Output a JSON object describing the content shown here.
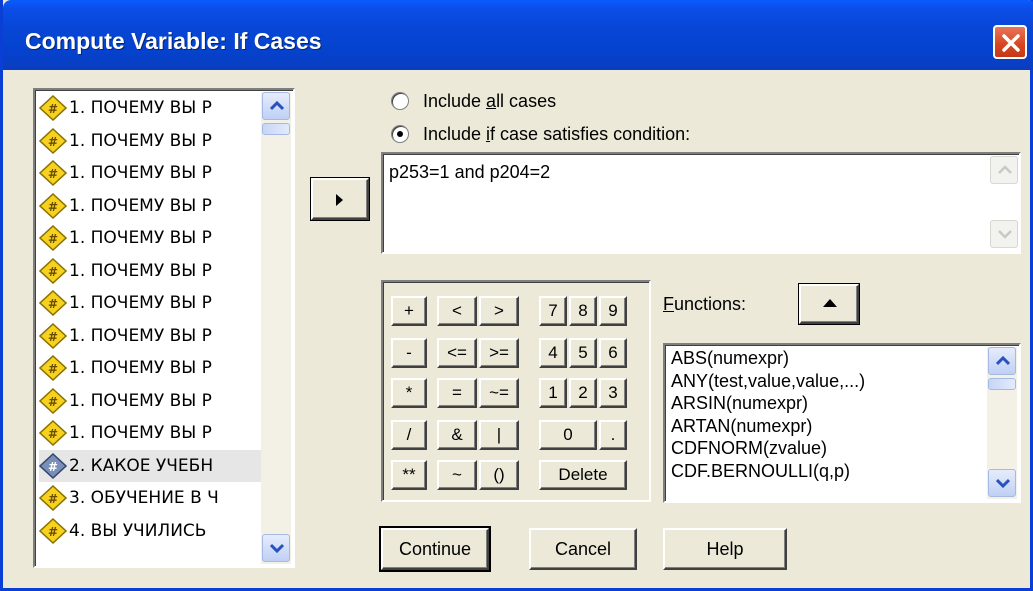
{
  "window": {
    "title": "Compute Variable: If Cases"
  },
  "variables": [
    {
      "label": "1. ПОЧЕМУ ВЫ Р",
      "type": "numeric-nominal",
      "selected": false
    },
    {
      "label": "1. ПОЧЕМУ ВЫ Р",
      "type": "numeric-nominal",
      "selected": false
    },
    {
      "label": "1. ПОЧЕМУ ВЫ Р",
      "type": "numeric-nominal",
      "selected": false
    },
    {
      "label": "1. ПОЧЕМУ ВЫ Р",
      "type": "numeric-nominal",
      "selected": false
    },
    {
      "label": "1. ПОЧЕМУ ВЫ Р",
      "type": "numeric-nominal",
      "selected": false
    },
    {
      "label": "1. ПОЧЕМУ ВЫ Р",
      "type": "numeric-nominal",
      "selected": false
    },
    {
      "label": "1. ПОЧЕМУ ВЫ Р",
      "type": "numeric-nominal",
      "selected": false
    },
    {
      "label": "1. ПОЧЕМУ ВЫ Р",
      "type": "numeric-nominal",
      "selected": false
    },
    {
      "label": "1. ПОЧЕМУ ВЫ Р",
      "type": "numeric-nominal",
      "selected": false
    },
    {
      "label": "1. ПОЧЕМУ ВЫ Р",
      "type": "numeric-nominal",
      "selected": false
    },
    {
      "label": "1. ПОЧЕМУ ВЫ Р",
      "type": "numeric-nominal",
      "selected": false
    },
    {
      "label": "2. КАКОЕ УЧЕБН",
      "type": "numeric-scale",
      "selected": true
    },
    {
      "label": "3. ОБУЧЕНИЕ В Ч",
      "type": "numeric-nominal",
      "selected": false
    },
    {
      "label": "4. ВЫ УЧИЛИСЬ",
      "type": "numeric-nominal",
      "selected": false
    }
  ],
  "options": {
    "include_all_pre": "Include ",
    "include_all_key": "a",
    "include_all_post": "ll cases",
    "include_if_pre": "Include ",
    "include_if_key": "i",
    "include_if_post": "f case satisfies condition:",
    "selected": "include_if"
  },
  "condition": {
    "expression": "p253=1 and p204=2"
  },
  "keypad": {
    "row1": [
      "+",
      "<",
      ">",
      "7",
      "8",
      "9"
    ],
    "row2": [
      "-",
      "<=",
      ">=",
      "4",
      "5",
      "6"
    ],
    "row3": [
      "*",
      "=",
      "~=",
      "1",
      "2",
      "3"
    ],
    "row4": [
      "/",
      "&",
      "|",
      "0",
      "."
    ],
    "row5": [
      "**",
      "~",
      "()",
      "Delete"
    ]
  },
  "functions": {
    "label_key": "F",
    "label_rest": "unctions:",
    "items": [
      "ABS(numexpr)",
      "ANY(test,value,value,...)",
      "ARSIN(numexpr)",
      "ARTAN(numexpr)",
      "CDFNORM(zvalue)",
      "CDF.BERNOULLI(q,p)"
    ]
  },
  "buttons": {
    "continue": "Continue",
    "cancel": "Cancel",
    "help": "Help"
  },
  "colors": {
    "titlebar": "#0846d6",
    "dialog_bg": "#ece9d8",
    "close": "#d6451f"
  }
}
